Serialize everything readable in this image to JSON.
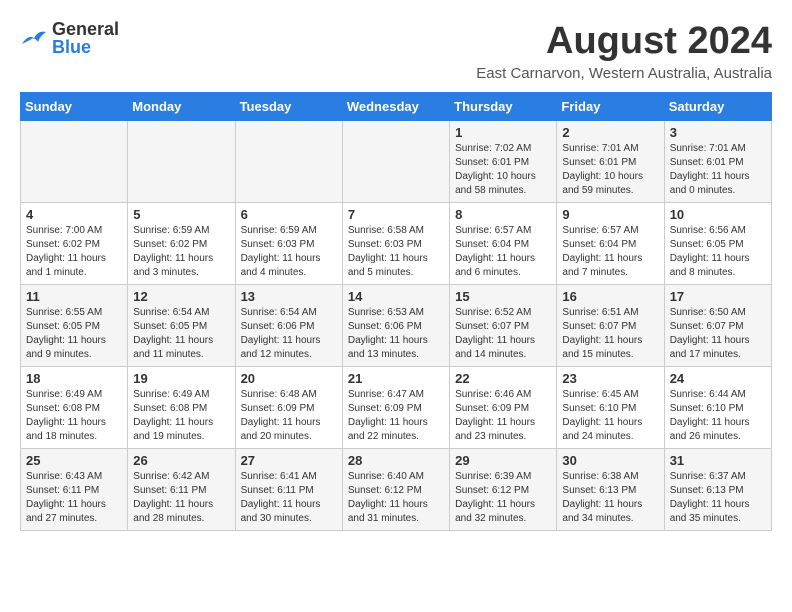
{
  "logo": {
    "general": "General",
    "blue": "Blue"
  },
  "title": "August 2024",
  "location": "East Carnarvon, Western Australia, Australia",
  "headers": [
    "Sunday",
    "Monday",
    "Tuesday",
    "Wednesday",
    "Thursday",
    "Friday",
    "Saturday"
  ],
  "weeks": [
    [
      {
        "day": "",
        "info": ""
      },
      {
        "day": "",
        "info": ""
      },
      {
        "day": "",
        "info": ""
      },
      {
        "day": "",
        "info": ""
      },
      {
        "day": "1",
        "info": "Sunrise: 7:02 AM\nSunset: 6:01 PM\nDaylight: 10 hours\nand 58 minutes."
      },
      {
        "day": "2",
        "info": "Sunrise: 7:01 AM\nSunset: 6:01 PM\nDaylight: 10 hours\nand 59 minutes."
      },
      {
        "day": "3",
        "info": "Sunrise: 7:01 AM\nSunset: 6:01 PM\nDaylight: 11 hours\nand 0 minutes."
      }
    ],
    [
      {
        "day": "4",
        "info": "Sunrise: 7:00 AM\nSunset: 6:02 PM\nDaylight: 11 hours\nand 1 minute."
      },
      {
        "day": "5",
        "info": "Sunrise: 6:59 AM\nSunset: 6:02 PM\nDaylight: 11 hours\nand 3 minutes."
      },
      {
        "day": "6",
        "info": "Sunrise: 6:59 AM\nSunset: 6:03 PM\nDaylight: 11 hours\nand 4 minutes."
      },
      {
        "day": "7",
        "info": "Sunrise: 6:58 AM\nSunset: 6:03 PM\nDaylight: 11 hours\nand 5 minutes."
      },
      {
        "day": "8",
        "info": "Sunrise: 6:57 AM\nSunset: 6:04 PM\nDaylight: 11 hours\nand 6 minutes."
      },
      {
        "day": "9",
        "info": "Sunrise: 6:57 AM\nSunset: 6:04 PM\nDaylight: 11 hours\nand 7 minutes."
      },
      {
        "day": "10",
        "info": "Sunrise: 6:56 AM\nSunset: 6:05 PM\nDaylight: 11 hours\nand 8 minutes."
      }
    ],
    [
      {
        "day": "11",
        "info": "Sunrise: 6:55 AM\nSunset: 6:05 PM\nDaylight: 11 hours\nand 9 minutes."
      },
      {
        "day": "12",
        "info": "Sunrise: 6:54 AM\nSunset: 6:05 PM\nDaylight: 11 hours\nand 11 minutes."
      },
      {
        "day": "13",
        "info": "Sunrise: 6:54 AM\nSunset: 6:06 PM\nDaylight: 11 hours\nand 12 minutes."
      },
      {
        "day": "14",
        "info": "Sunrise: 6:53 AM\nSunset: 6:06 PM\nDaylight: 11 hours\nand 13 minutes."
      },
      {
        "day": "15",
        "info": "Sunrise: 6:52 AM\nSunset: 6:07 PM\nDaylight: 11 hours\nand 14 minutes."
      },
      {
        "day": "16",
        "info": "Sunrise: 6:51 AM\nSunset: 6:07 PM\nDaylight: 11 hours\nand 15 minutes."
      },
      {
        "day": "17",
        "info": "Sunrise: 6:50 AM\nSunset: 6:07 PM\nDaylight: 11 hours\nand 17 minutes."
      }
    ],
    [
      {
        "day": "18",
        "info": "Sunrise: 6:49 AM\nSunset: 6:08 PM\nDaylight: 11 hours\nand 18 minutes."
      },
      {
        "day": "19",
        "info": "Sunrise: 6:49 AM\nSunset: 6:08 PM\nDaylight: 11 hours\nand 19 minutes."
      },
      {
        "day": "20",
        "info": "Sunrise: 6:48 AM\nSunset: 6:09 PM\nDaylight: 11 hours\nand 20 minutes."
      },
      {
        "day": "21",
        "info": "Sunrise: 6:47 AM\nSunset: 6:09 PM\nDaylight: 11 hours\nand 22 minutes."
      },
      {
        "day": "22",
        "info": "Sunrise: 6:46 AM\nSunset: 6:09 PM\nDaylight: 11 hours\nand 23 minutes."
      },
      {
        "day": "23",
        "info": "Sunrise: 6:45 AM\nSunset: 6:10 PM\nDaylight: 11 hours\nand 24 minutes."
      },
      {
        "day": "24",
        "info": "Sunrise: 6:44 AM\nSunset: 6:10 PM\nDaylight: 11 hours\nand 26 minutes."
      }
    ],
    [
      {
        "day": "25",
        "info": "Sunrise: 6:43 AM\nSunset: 6:11 PM\nDaylight: 11 hours\nand 27 minutes."
      },
      {
        "day": "26",
        "info": "Sunrise: 6:42 AM\nSunset: 6:11 PM\nDaylight: 11 hours\nand 28 minutes."
      },
      {
        "day": "27",
        "info": "Sunrise: 6:41 AM\nSunset: 6:11 PM\nDaylight: 11 hours\nand 30 minutes."
      },
      {
        "day": "28",
        "info": "Sunrise: 6:40 AM\nSunset: 6:12 PM\nDaylight: 11 hours\nand 31 minutes."
      },
      {
        "day": "29",
        "info": "Sunrise: 6:39 AM\nSunset: 6:12 PM\nDaylight: 11 hours\nand 32 minutes."
      },
      {
        "day": "30",
        "info": "Sunrise: 6:38 AM\nSunset: 6:13 PM\nDaylight: 11 hours\nand 34 minutes."
      },
      {
        "day": "31",
        "info": "Sunrise: 6:37 AM\nSunset: 6:13 PM\nDaylight: 11 hours\nand 35 minutes."
      }
    ]
  ]
}
